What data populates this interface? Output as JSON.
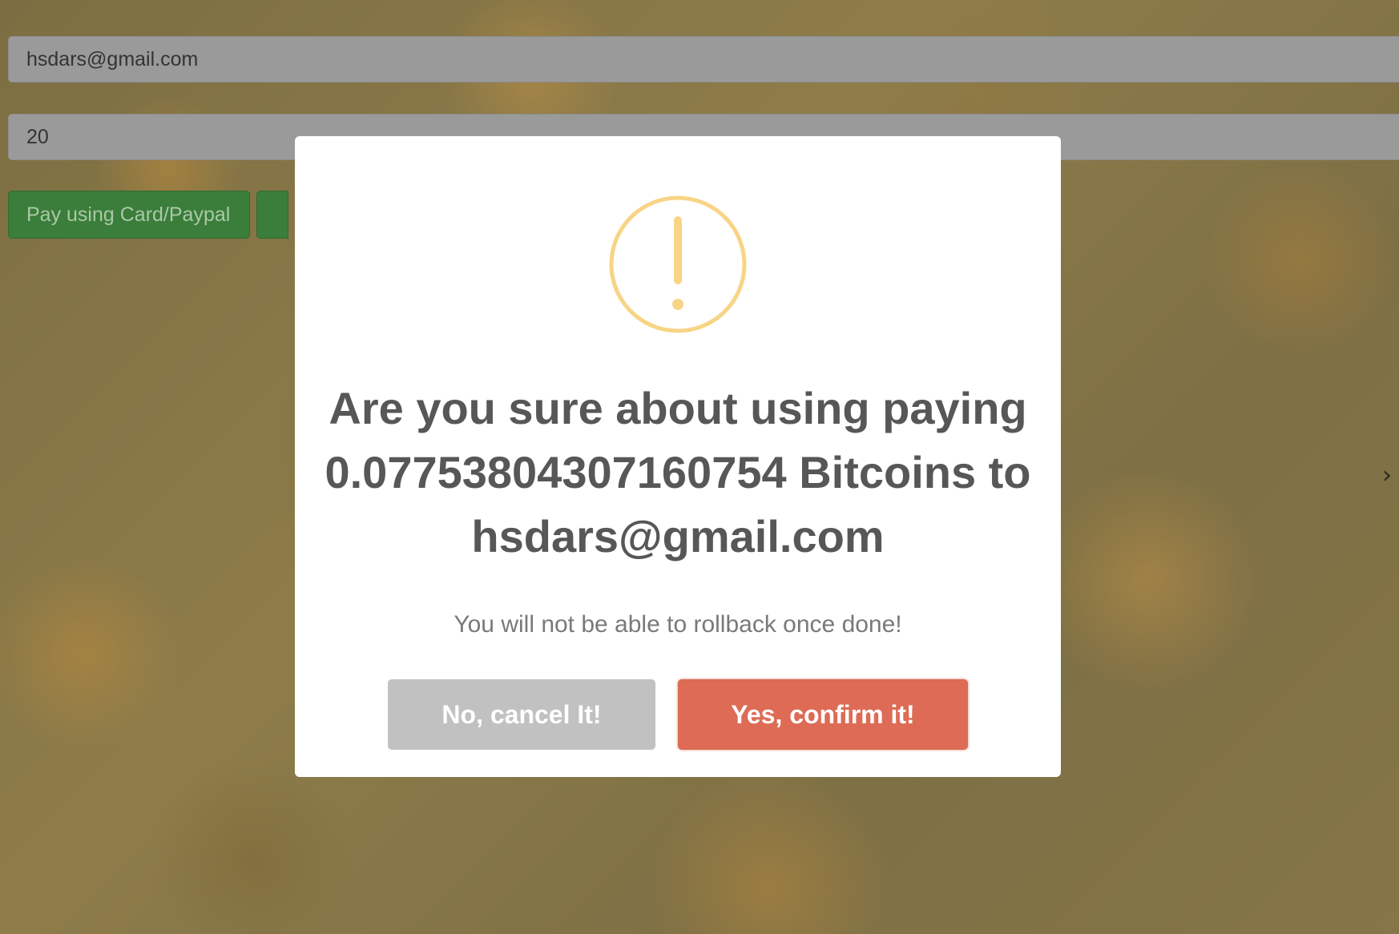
{
  "form": {
    "email_value": "hsdars@gmail.com",
    "amount_value": "20",
    "pay_button_label": "Pay using Card/Paypal"
  },
  "page": {
    "side_chevron": "›"
  },
  "modal": {
    "icon": "warning-icon",
    "icon_color": "#f8d486",
    "title": "Are you sure about using paying 0.07753804307160754 Bitcoins to hsdars@gmail.com",
    "text": "You will not be able to rollback once done!",
    "cancel_label": "No, cancel It!",
    "confirm_label": "Yes, confirm it!",
    "confirm_color": "#dd6b55",
    "cancel_color": "#c1c1c1"
  }
}
